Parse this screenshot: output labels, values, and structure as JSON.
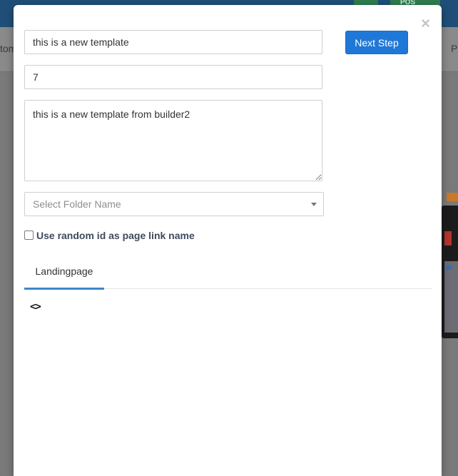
{
  "background": {
    "left_fragment": "tom",
    "right_fragment": "P",
    "top_button_label": "POS"
  },
  "modal": {
    "close_glyph": "×",
    "next_step_label": "Next Step",
    "template_name": "this is a new template",
    "number_value": "7",
    "description": "this is a new template from builder2",
    "folder_select": {
      "placeholder": "Select Folder Name"
    },
    "random_id_checkbox": {
      "label": "Use random id as page link name",
      "checked": false
    },
    "tabs": [
      {
        "label": "Landingpage",
        "active": true
      }
    ],
    "code_icon_glyph": "<>"
  },
  "colors": {
    "primary": "#1f78d7",
    "tab_active_border": "#3d87c9",
    "overlay": "#7a7a7a",
    "topbar": "#1f4f78"
  }
}
